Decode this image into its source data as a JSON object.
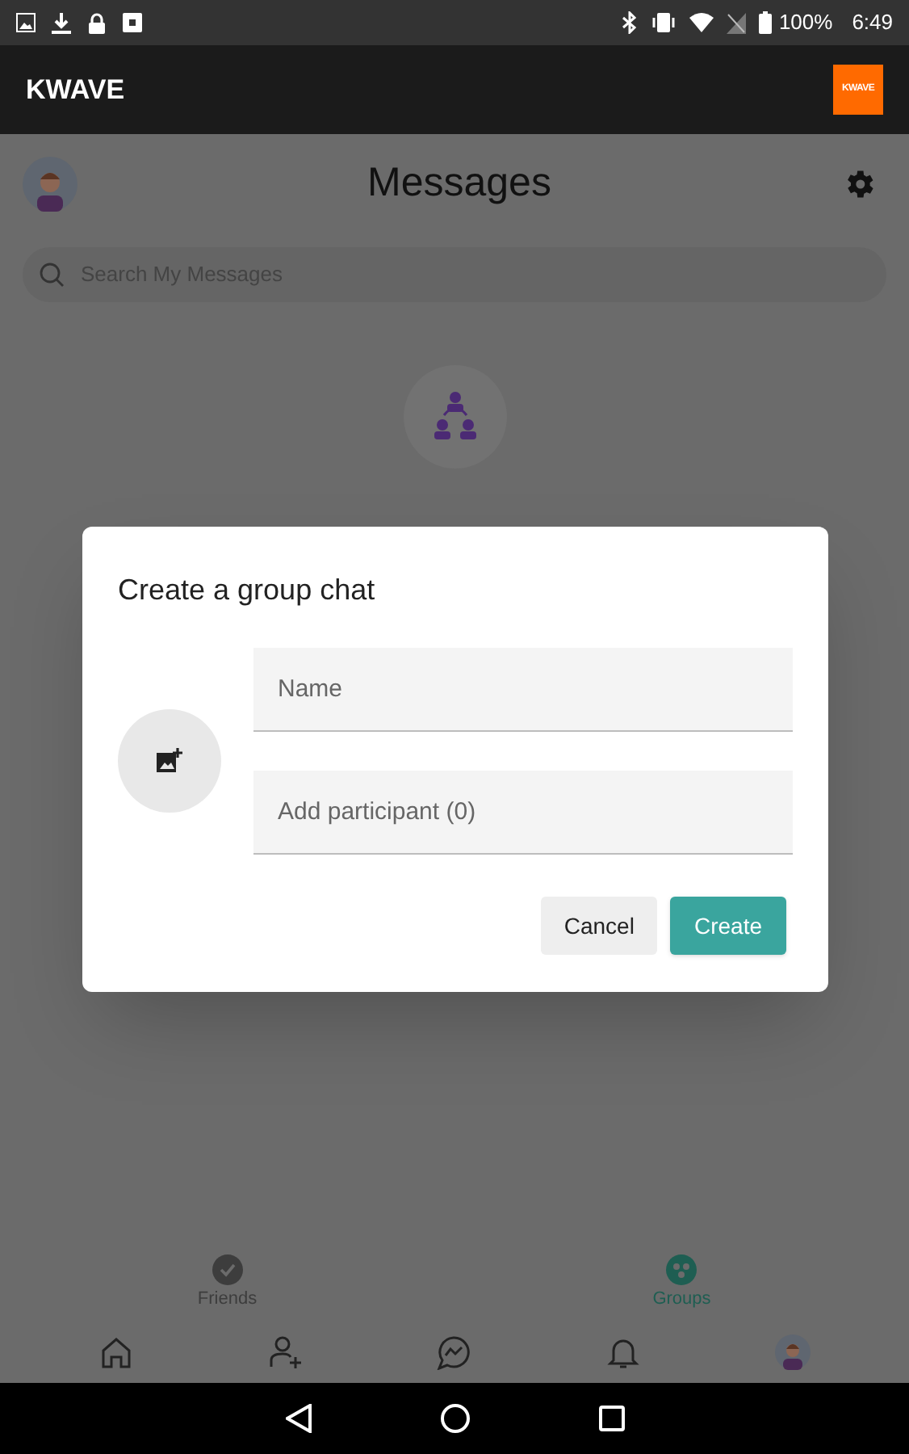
{
  "status_bar": {
    "battery": "100%",
    "time": "6:49"
  },
  "app_bar": {
    "title": "KWAVE",
    "logo_text": "KWAVE"
  },
  "header": {
    "title": "Messages"
  },
  "search": {
    "placeholder": "Search My Messages"
  },
  "dialog": {
    "title": "Create a group chat",
    "fields": [
      {
        "placeholder": "Name"
      },
      {
        "placeholder": "Add participant (0)"
      }
    ],
    "buttons": [
      {
        "label": "Cancel",
        "kind": "secondary"
      },
      {
        "label": "Create",
        "kind": "primary"
      }
    ]
  },
  "tabs": [
    {
      "label": "Friends",
      "selected": false
    },
    {
      "label": "Groups",
      "selected": true
    }
  ],
  "bottom_nav": [
    {
      "kind": "home"
    },
    {
      "kind": "add-friend"
    },
    {
      "kind": "chat"
    },
    {
      "kind": "bell"
    },
    {
      "kind": "avatar"
    }
  ]
}
